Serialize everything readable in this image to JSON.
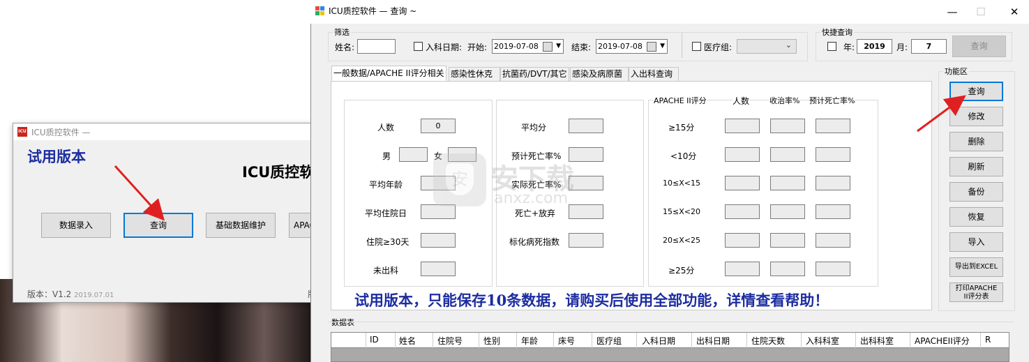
{
  "back_window": {
    "title": "ICU质控软件 —",
    "logo_text": "ICU",
    "trial_label": "试用版本",
    "app_title": "ICU质控软件",
    "buttons": [
      "数据录入",
      "查询",
      "基础数据维护",
      "APACHE II"
    ],
    "version_label": "版本：V1.2",
    "version_date": "2019.07.01",
    "right_edge_text": "版"
  },
  "main_window": {
    "title": "ICU质控软件 — 查询  ~",
    "controls": {
      "minimize": "—",
      "maximize": "☐",
      "close": "✕"
    },
    "filter": {
      "legend": "筛选",
      "name_label": "姓名:",
      "name_value": "",
      "admit_check_label": "入科日期:",
      "start_label": "开始:",
      "start_value": "2019-07-08",
      "end_label": "结束:",
      "end_value": "2019-07-08",
      "team_check_label": "医疗组:",
      "team_value": ""
    },
    "quick": {
      "legend": "快捷查询",
      "year_label": "年:",
      "year_value": "2019",
      "month_label": "月:",
      "month_value": "7",
      "query_button": "查询"
    },
    "tabs": [
      "一般数据/APACHE II评分相关",
      "感染性休克",
      "抗菌药/DVT/其它",
      "感染及病原菌",
      "入出科查询"
    ],
    "stats": {
      "col1": {
        "count_label": "人数",
        "count_value": "0",
        "male_label": "男",
        "female_label": "女",
        "avg_age_label": "平均年龄",
        "avg_stay_label": "平均住院日",
        "stay30_label": "住院≥30天",
        "not_discharged_label": "未出科"
      },
      "col2": {
        "avg_score_label": "平均分",
        "pred_mort_label": "预计死亡率%",
        "actual_mort_label": "实际死亡率%",
        "death_abandon_label": "死亡+放弃",
        "smr_label": "标化病死指数"
      },
      "col3": {
        "headers": [
          "APACHE II评分",
          "人数",
          "收治率%",
          "预计死亡率%"
        ],
        "rows": [
          "≥15分",
          "<10分",
          "10≤X<15",
          "15≤X<20",
          "20≤X<25",
          "≥25分"
        ]
      }
    },
    "function_area": {
      "legend": "功能区",
      "buttons": [
        "查询",
        "修改",
        "删除",
        "刷新",
        "备份",
        "恢复",
        "导入",
        "导出到EXCEL"
      ],
      "print_button_line1": "打印APACHE",
      "print_button_line2": "II评分表"
    },
    "trial_notice": "试用版本，只能保存10条数据，请购买后使用全部功能，详情查看帮助！",
    "data_table": {
      "legend": "数据表",
      "columns": [
        "ID",
        "姓名",
        "住院号",
        "性别",
        "年龄",
        "床号",
        "医疗组",
        "入科日期",
        "出科日期",
        "住院天数",
        "入科科室",
        "出科科室",
        "APACHEII评分",
        "R"
      ]
    },
    "watermark": {
      "line1": "安下载",
      "line2": "anxz.com"
    }
  },
  "colors": {
    "accent": "#0078d7",
    "trial_text": "#1c2da0",
    "arrow": "#e02020"
  }
}
